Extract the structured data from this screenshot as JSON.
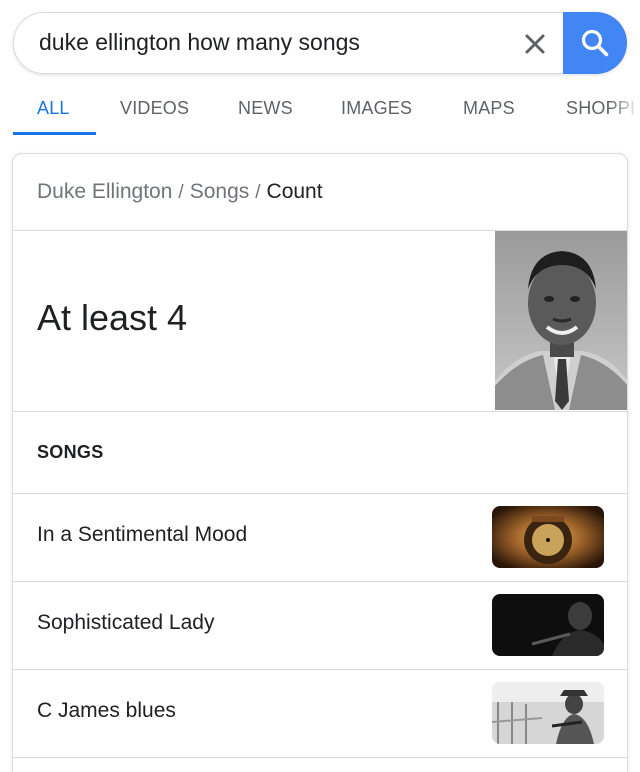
{
  "search": {
    "query": "duke ellington how many songs"
  },
  "tabs": [
    {
      "label": "ALL",
      "active": true
    },
    {
      "label": "VIDEOS",
      "active": false
    },
    {
      "label": "NEWS",
      "active": false
    },
    {
      "label": "IMAGES",
      "active": false
    },
    {
      "label": "MAPS",
      "active": false
    },
    {
      "label": "SHOPPI",
      "active": false
    }
  ],
  "card": {
    "breadcrumb": [
      "Duke Ellington",
      "Songs",
      "Count"
    ],
    "answer": "At least 4",
    "section_title": "SONGS",
    "songs": [
      {
        "title": "In a Sentimental Mood"
      },
      {
        "title": "Sophisticated Lady"
      },
      {
        "title": "C James blues"
      }
    ]
  },
  "colors": {
    "accent": "#1a73e8",
    "search_button": "#4285f4",
    "muted_text": "#70757a",
    "divider": "#dadce0"
  }
}
